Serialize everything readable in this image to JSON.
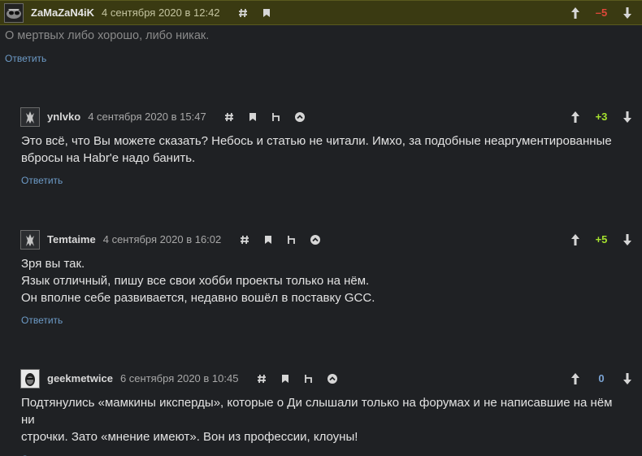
{
  "reply_label": "Ответить",
  "colors": {
    "background": "#1f2124",
    "highlight": "#3a3a12",
    "negative": "#e0483a",
    "positive": "#a6e22e",
    "neutral": "#7ba4d4",
    "link": "#6d9bc7"
  },
  "icons": [
    "hash-icon",
    "bookmark-icon",
    "parent-icon",
    "chevron-up-circle-icon",
    "arrow-up-icon",
    "arrow-down-icon"
  ],
  "comments": [
    {
      "username": "ZaMaZaN4iK",
      "date": "4 сентября 2020 в 12:42",
      "score": "–5",
      "text": "О мертвых либо хорошо, либо никак."
    },
    {
      "username": "ynlvko",
      "date": "4 сентября 2020 в 15:47",
      "score": "+3",
      "text": "Это всё, что Вы можете сказать? Небось и статью не читали. Имхо, за подобные неаргументированные\nвбросы на Habr'е надо банить."
    },
    {
      "username": "Temtaime",
      "date": "4 сентября 2020 в 16:02",
      "score": "+5",
      "text": "Зря вы так.\nЯзык отличный, пишу все свои хобби проекты только на нём.\nОн вполне себе развивается, недавно вошёл в поставку GCC."
    },
    {
      "username": "geekmetwice",
      "date": "6 сентября 2020 в 10:45",
      "score": "0",
      "text": "Подтянулись «мамкины иксперды», которые о Ди слышали только на форумах и не написавшие на нём ни\nстрочки. Зато «мнение имеют». Вон из профессии, клоуны!"
    }
  ]
}
